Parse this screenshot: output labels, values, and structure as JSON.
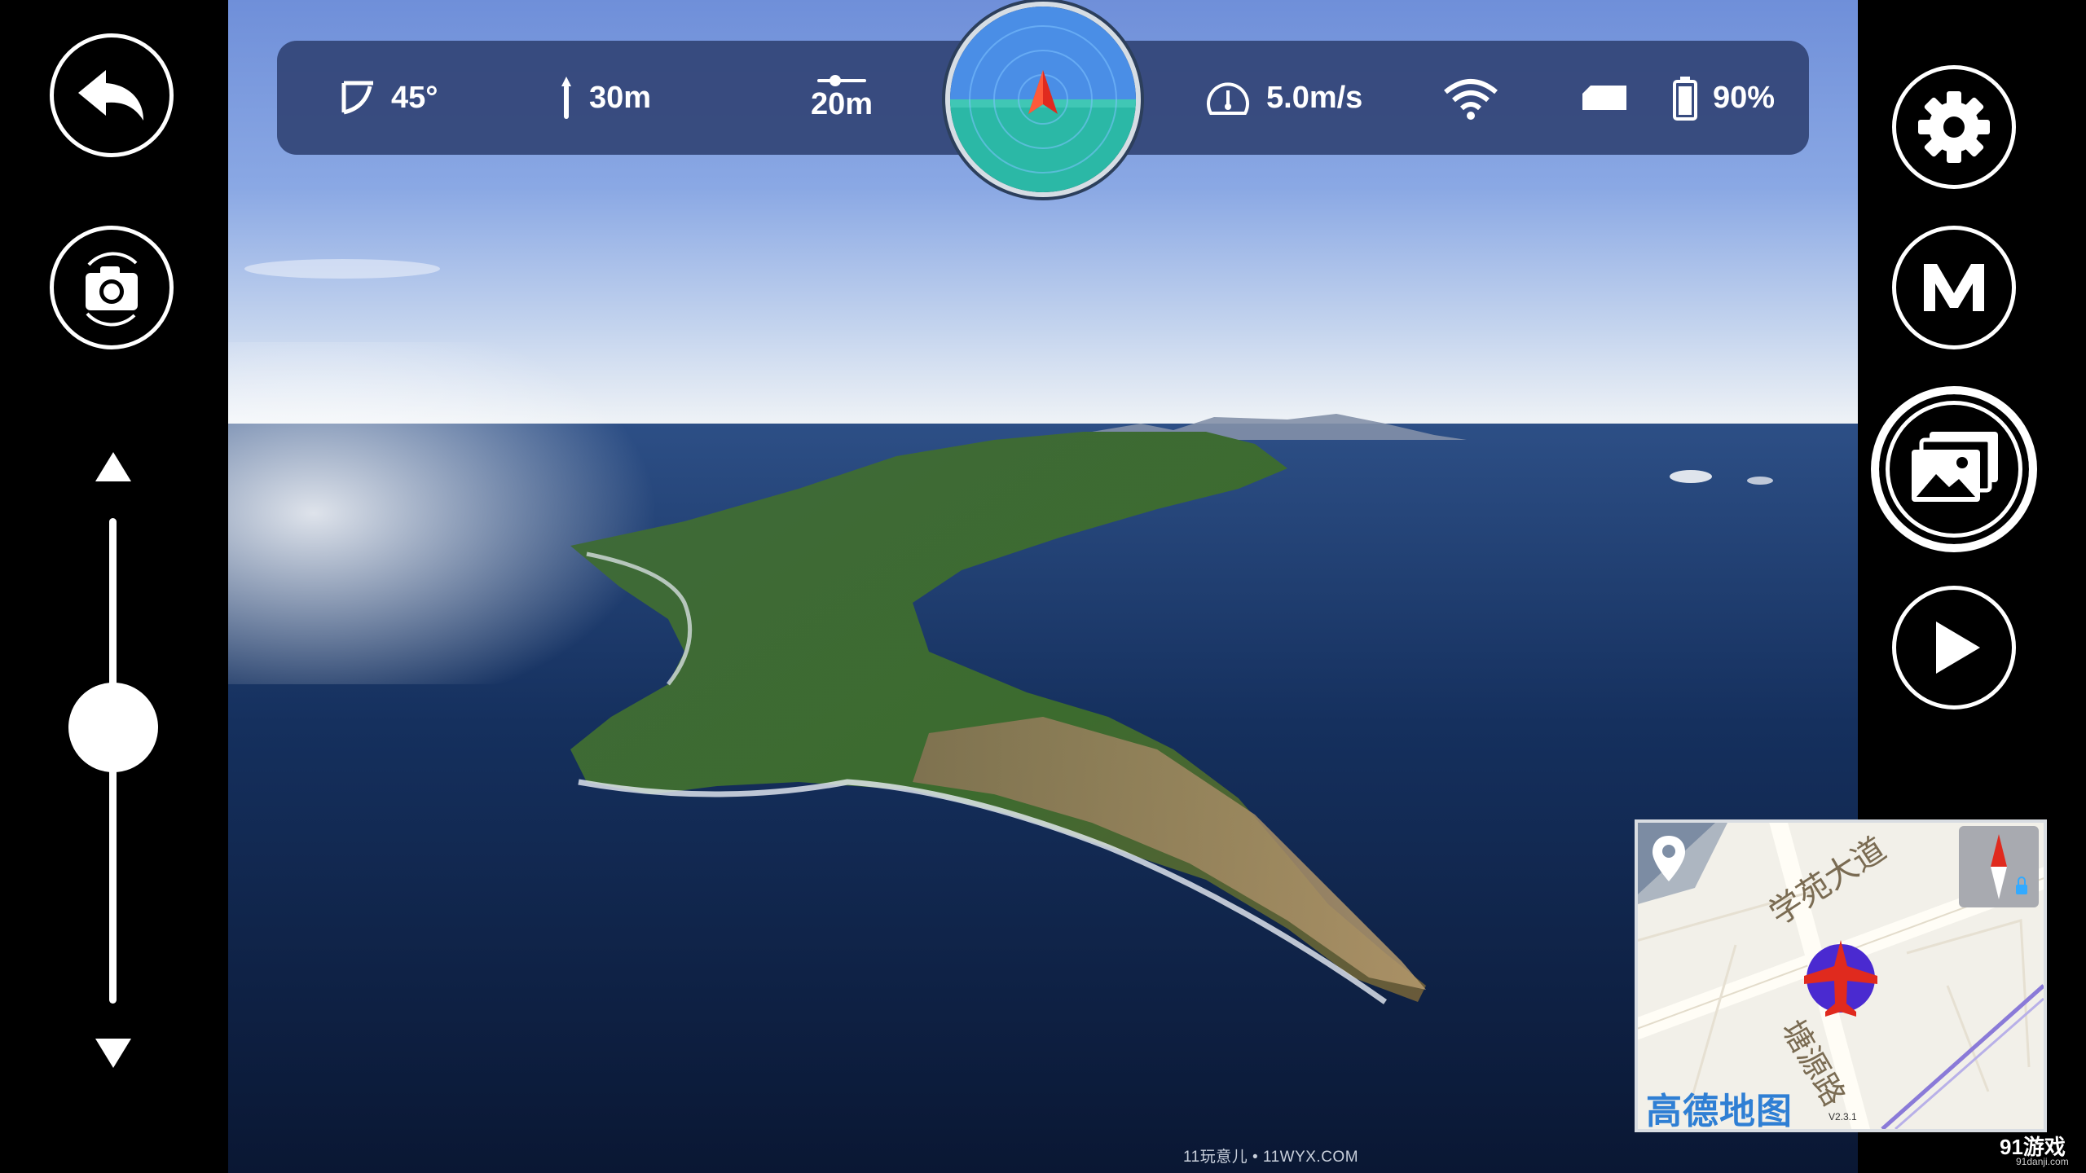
{
  "status": {
    "tilt": "45°",
    "altitude": "30m",
    "distance": "20m",
    "speed": "5.0m/s",
    "battery": "90%"
  },
  "map": {
    "road1": "学苑大道",
    "road2": "塘源路",
    "provider": "高德地图",
    "version": "V2.3.1"
  },
  "watermark": "11玩意儿 • 11WYX.COM",
  "corner_logo": "91游戏",
  "corner_sub": "91danji.com",
  "colors": {
    "status_bar": "#324476",
    "accent_red": "#e02a1e",
    "map_marker": "#4a2ad0"
  }
}
